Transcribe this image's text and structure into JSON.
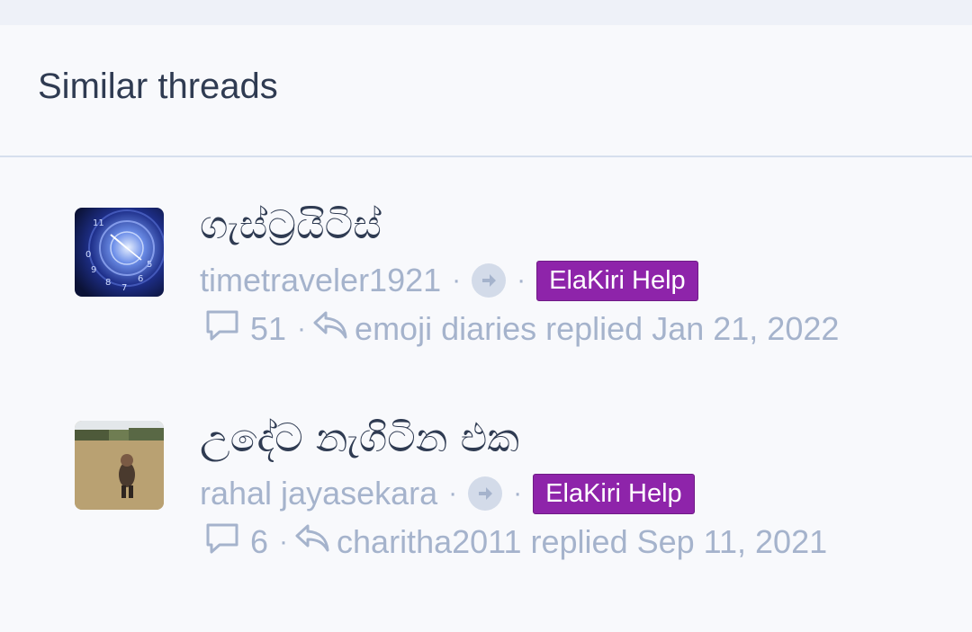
{
  "block": {
    "title": "Similar threads"
  },
  "threads": [
    {
      "title": "ගැස්ට්‍රයිටිස්",
      "author": "timetraveler1921",
      "forum": "ElaKiri Help",
      "replies": "51",
      "last_reply": "emoji diaries replied Jan 21, 2022"
    },
    {
      "title": "උදේට නැගිටින එක",
      "author": "rahal jayasekara",
      "forum": "ElaKiri Help",
      "replies": "6",
      "last_reply": "charitha2011 replied Sep 11, 2021"
    }
  ],
  "meta": {
    "separator": "·"
  },
  "colors": {
    "badge": "#8e24aa",
    "muted": "#a5b3cc",
    "title": "#2f3b52"
  }
}
